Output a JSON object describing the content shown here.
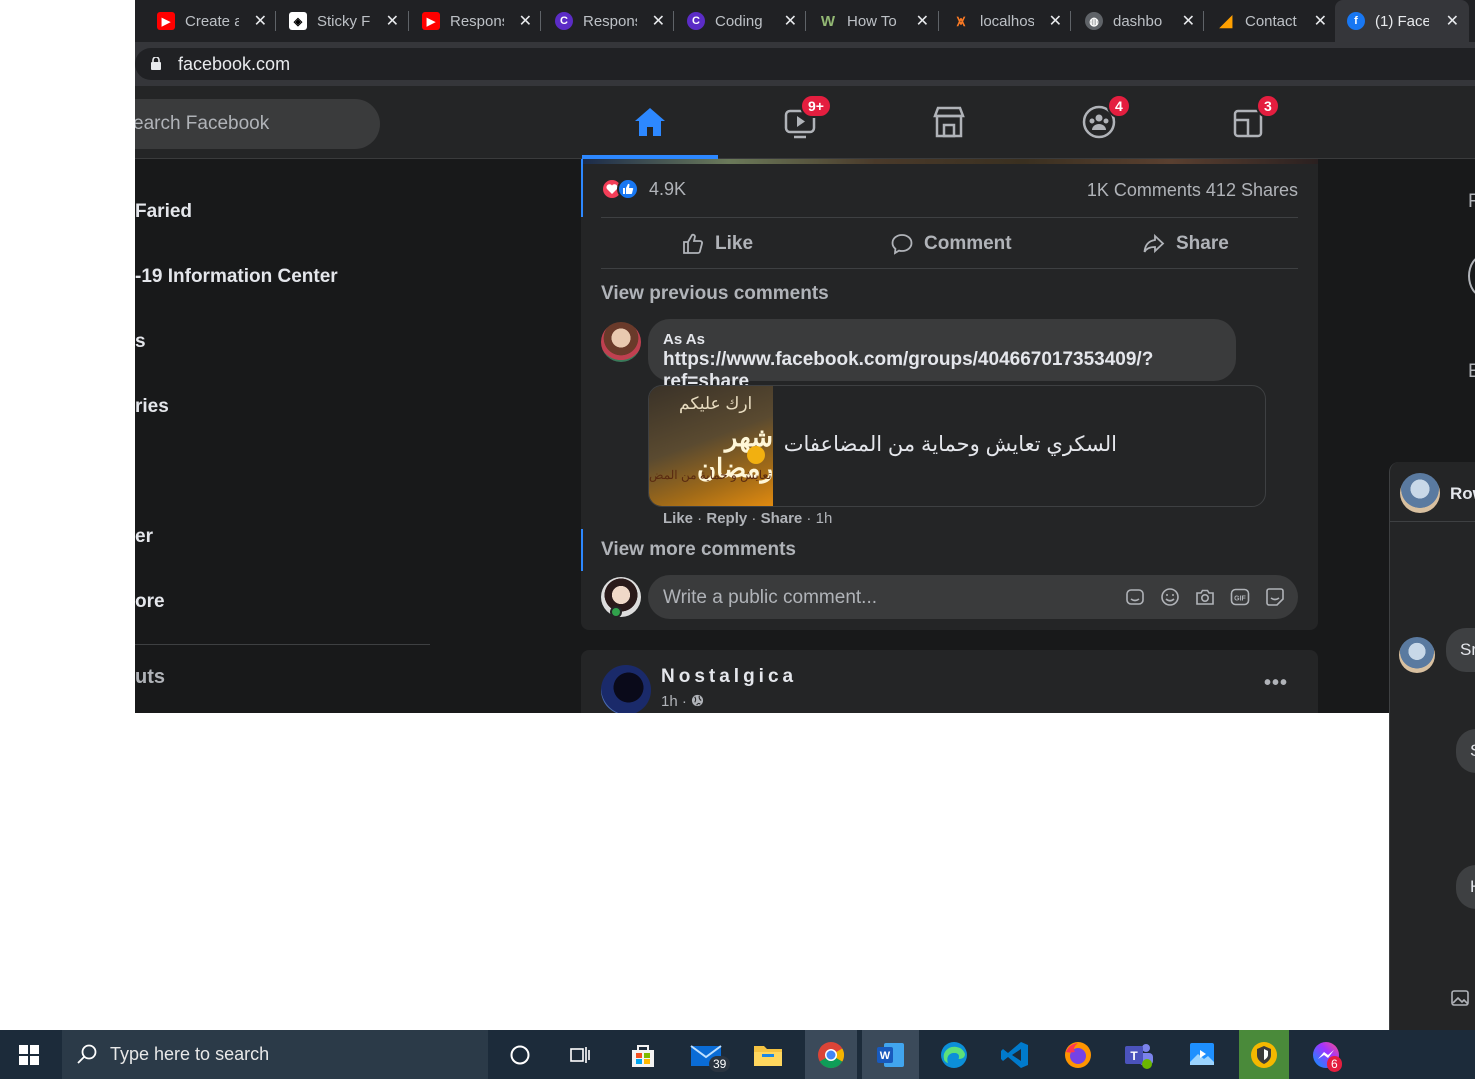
{
  "browser": {
    "tabs": [
      {
        "label": "Create a",
        "icon": "youtube-icon",
        "color": "#ff0000"
      },
      {
        "label": "Sticky F",
        "icon": "codepen-icon",
        "color": "#ffffff"
      },
      {
        "label": "Respons",
        "icon": "youtube-icon",
        "color": "#ff0000"
      },
      {
        "label": "Respons",
        "icon": "codingnepal-icon",
        "color": "#5b2cc6"
      },
      {
        "label": "Coding",
        "icon": "codingnepal-icon",
        "color": "#5b2cc6"
      },
      {
        "label": "How To",
        "icon": "wikihow-icon",
        "color": "#93b874"
      },
      {
        "label": "localhos",
        "icon": "xampp-icon",
        "color": "#fb7a24"
      },
      {
        "label": "dashbo",
        "icon": "globe-icon",
        "color": "#9aa0a6"
      },
      {
        "label": "Contact",
        "icon": "firebase-icon",
        "color": "#ffa000"
      },
      {
        "label": "(1) Face",
        "icon": "facebook-icon",
        "color": "#1877f2"
      }
    ],
    "url": "facebook.com"
  },
  "fb": {
    "search_placeholder": "earch Facebook",
    "nav": {
      "watch_badge": "9+",
      "groups_badge": "4",
      "gaming_badge": "3"
    },
    "sidebar": [
      " Faried",
      "-19 Information Center",
      "s",
      "ries",
      "er",
      "ore"
    ],
    "shortcuts_label": "uts",
    "post": {
      "reaction_count": "4.9K",
      "comments": "1K Comments",
      "shares": "412 Shares",
      "like": "Like",
      "comment": "Comment",
      "share": "Share",
      "view_previous": "View previous comments",
      "comment_author": "As As",
      "comment_link": "https://www.facebook.com/groups/404667017353409/?ref=share",
      "link_title": "السكري تعايش وحماية من المضاعفات",
      "thumb_text": [
        "ارك عليكم",
        "شهر رمضان",
        "تعايش و حماية من المض"
      ],
      "comment_actions": {
        "like": "Like",
        "reply": "Reply",
        "share": "Share",
        "time": "1h"
      },
      "view_more": "View more comments",
      "input_placeholder": "Write a public comment..."
    },
    "post2": {
      "author": "Nostalgica",
      "time": "1h"
    },
    "right_col": {
      "letter1": "F",
      "letter2": "E"
    },
    "chat": {
      "name": "Row",
      "messages": [
        "Sr",
        "Sa",
        "Ha"
      ]
    }
  },
  "taskbar": {
    "search_placeholder": "Type here to search",
    "mail_count": "39",
    "messenger_count": "6"
  },
  "colors": {
    "fb_blue": "#2d88ff",
    "badge_red": "#e41e3f",
    "fb_bg": "#18191a",
    "card_bg": "#242526"
  }
}
